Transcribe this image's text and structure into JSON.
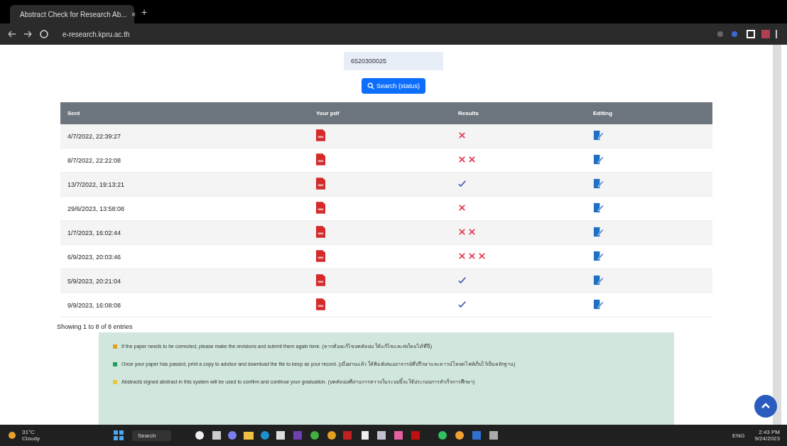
{
  "browser": {
    "tab_title": "Abstract Check for Research Ab...",
    "tab_close": "×",
    "new_tab": "+",
    "url": "e-research.kpru.ac.th"
  },
  "search": {
    "value": "6520300025",
    "button": "Search (status)"
  },
  "table": {
    "columns": [
      "Sent",
      "Your pdf",
      "Results",
      "Editing"
    ],
    "rows": [
      {
        "sent": "4/7/2022, 22:39:27",
        "marks": [
          {
            "kind": "cross"
          }
        ]
      },
      {
        "sent": "8/7/2022, 22:22:08",
        "marks": [
          {
            "kind": "cross"
          },
          {
            "kind": "cross"
          }
        ]
      },
      {
        "sent": "13/7/2022, 19:13:21",
        "marks": [
          {
            "kind": "check"
          }
        ]
      },
      {
        "sent": "29/6/2023, 13:58:08",
        "marks": [
          {
            "kind": "cross"
          }
        ]
      },
      {
        "sent": "1/7/2023, 16:02:44",
        "marks": [
          {
            "kind": "cross"
          },
          {
            "kind": "cross"
          }
        ]
      },
      {
        "sent": "6/9/2023, 20:03:46",
        "marks": [
          {
            "kind": "cross"
          },
          {
            "kind": "cross"
          },
          {
            "kind": "cross"
          }
        ]
      },
      {
        "sent": "5/9/2023, 20:21:04",
        "marks": [
          {
            "kind": "check"
          }
        ]
      },
      {
        "sent": "9/9/2023, 16:08:08",
        "marks": [
          {
            "kind": "check"
          }
        ]
      }
    ]
  },
  "info": "Showing 1 to 8 of 8 entries",
  "notes": [
    {
      "color": "#e0a020",
      "text": "If the paper needs to be corrected, please make the revisions and submit them again here. (หากต้องแก้ไขบทคัดย่อ ให้แก้ไขและส่งใหม่ได้ที่นี่)"
    },
    {
      "color": "#20a060",
      "text": "Once your paper has passed, print a copy to advisor and download the file to keep as your record. (เมื่อผ่านแล้ว ให้พิมพ์เสนออาจารย์ที่ปรึกษาและดาวน์โหลดไฟล์เก็บไว้เป็นหลักฐาน)"
    },
    {
      "color": "#e8c840",
      "text": "Abstracts signed abstract in this system will be used to confirm and continue your graduation. (บทคัดย่อที่ผ่านการตรวจในระบบนี้จะใช้ประกอบการสำเร็จการศึกษา)"
    }
  ],
  "taskbar": {
    "weather_temp": "31°C",
    "weather_text": "Cloudy",
    "search": "Search",
    "lang": "ENG",
    "time": "2:43 PM",
    "date": "9/24/2023"
  }
}
